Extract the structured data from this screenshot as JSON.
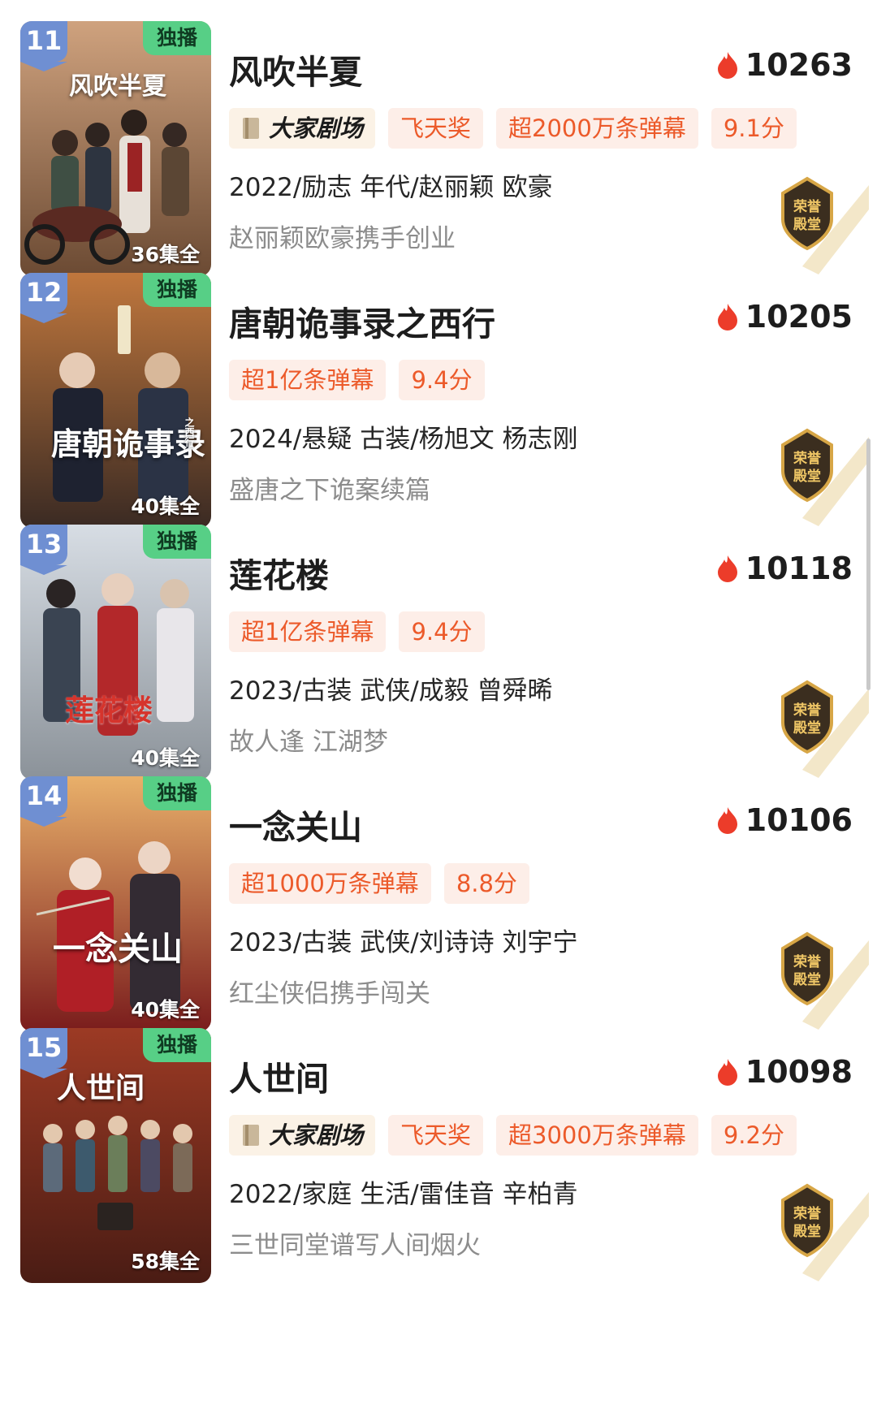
{
  "colors": {
    "rank_badge": "#6f8fd2",
    "exclusive_badge": "#57cf86",
    "tag_text": "#ec5a2a",
    "tag_bg": "#fdeee8",
    "heat_flame": "#ec3c2a"
  },
  "icons": {
    "heat": "flame-icon",
    "brand": "book-icon",
    "award": "hall-of-fame-badge-icon"
  },
  "items": [
    {
      "rank": "11",
      "exclusive": "独播",
      "poster_title": "风吹半夏",
      "episodes": "36集全",
      "title": "风吹半夏",
      "heat": "10263",
      "tags": [
        "大家剧场",
        "飞天奖",
        "超2000万条弹幕",
        "9.1分"
      ],
      "meta": "2022/励志 年代/赵丽颖 欧豪",
      "desc": "赵丽颖欧豪携手创业",
      "badge": "荣誉殿堂"
    },
    {
      "rank": "12",
      "exclusive": "独播",
      "poster_title": "唐朝诡事录",
      "poster_sub": "之西行",
      "episodes": "40集全",
      "title": "唐朝诡事录之西行",
      "heat": "10205",
      "tags": [
        "超1亿条弹幕",
        "9.4分"
      ],
      "meta": "2024/悬疑 古装/杨旭文 杨志刚",
      "desc": "盛唐之下诡案续篇",
      "badge": "荣誉殿堂"
    },
    {
      "rank": "13",
      "exclusive": "独播",
      "poster_title": "莲花楼",
      "episodes": "40集全",
      "title": "莲花楼",
      "heat": "10118",
      "tags": [
        "超1亿条弹幕",
        "9.4分"
      ],
      "meta": "2023/古装 武侠/成毅 曾舜晞",
      "desc": "故人逢 江湖梦",
      "badge": "荣誉殿堂"
    },
    {
      "rank": "14",
      "exclusive": "独播",
      "poster_title": "一念关山",
      "episodes": "40集全",
      "title": "一念关山",
      "heat": "10106",
      "tags": [
        "超1000万条弹幕",
        "8.8分"
      ],
      "meta": "2023/古装 武侠/刘诗诗 刘宇宁",
      "desc": "红尘侠侣携手闯关",
      "badge": "荣誉殿堂"
    },
    {
      "rank": "15",
      "exclusive": "独播",
      "poster_title": "人世间",
      "episodes": "58集全",
      "title": "人世间",
      "heat": "10098",
      "tags": [
        "大家剧场",
        "飞天奖",
        "超3000万条弹幕",
        "9.2分"
      ],
      "meta": "2022/家庭 生活/雷佳音 辛柏青",
      "desc": "三世同堂谱写人间烟火",
      "badge": "荣誉殿堂"
    }
  ]
}
